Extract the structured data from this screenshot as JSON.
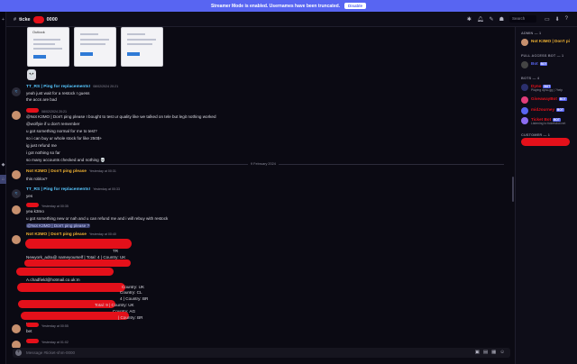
{
  "banner": {
    "text": "Streamer Mode is enabled. Usernames have been truncated.",
    "button": "Disable"
  },
  "guild_rail": {
    "items": [
      "+",
      "◆",
      "⌂"
    ]
  },
  "topbar": {
    "channel_prefix": "ticke",
    "channel_suffix": "0000",
    "search_placeholder": "Search",
    "icons": [
      "threads-icon",
      "bell-icon",
      "pin-icon",
      "members-icon",
      "search-icon",
      "inbox-icon",
      "help-icon"
    ]
  },
  "chat": {
    "thumb_title": "Outlook",
    "skull": "💀",
    "divider": "9 February 2024",
    "messages": [
      {
        "name": "TT_RS | Ping for replacements!",
        "color": "cyan",
        "ts": "08/02/2024 20:21",
        "lines": [
          "yeah just wait for a restock I guess",
          "the accs are bad"
        ]
      },
      {
        "name": "",
        "color": "red",
        "ts": "08/02/2024 20:21",
        "lines": [
          "@Not K3MO | Don't ping please I bought to test ur quality like we talked on tele but legit nothing worked",
          "@wolfyie if u don't remember",
          "u got something normal for me to test?",
          "so i can buy ur whole stock for like 250$+",
          "ig just refund me",
          "i got nothing so far",
          "so many accounts checked and nothing 💀"
        ]
      },
      {
        "name": "Not K3MO | Don't ping please",
        "color": "gold",
        "ts": "Yesterday at 00:31",
        "lines": [
          "this roblox?"
        ]
      },
      {
        "name": "TT_RS | Ping for replacements!",
        "color": "cyan",
        "ts": "Yesterday at 00:33",
        "lines": [
          "yes"
        ]
      },
      {
        "name": "",
        "color": "red",
        "ts": "Yesterday at 00:35",
        "lines": [
          "yea k3mo",
          "u got something new or nah and u can refund me and i will rebuy with restock",
          "@Not K3MO | Don't ping please ?"
        ]
      },
      {
        "name": "Not K3MO | Don't ping please",
        "color": "gold",
        "ts": "Yesterday at 00:40",
        "lines": [
          "TR",
          "Newyork_adra@  nameyourself | Total: 4 | Country: UK",
          "",
          "",
          "A.chadfield@hotmail.co.uk:m",
          "Country: UK",
          "Country: CL",
          "4 | Country: BR",
          "Total: 9 | Country: UK",
          "Country: AG",
          "| Country: BR",
          "try"
        ]
      },
      {
        "name": "",
        "color": "red",
        "ts": "Yesterday at 00:55",
        "lines": [
          "bet"
        ]
      },
      {
        "name": "",
        "color": "red",
        "ts": "Yesterday at 01:02",
        "lines": []
      }
    ]
  },
  "composer": {
    "placeholder": "Message #ticket-shm-0000"
  },
  "members": {
    "groups": [
      {
        "label": "ADMIN — 1",
        "members": [
          {
            "name": "Not K3MO | Don't pi",
            "color": "#f0b232",
            "sub": ""
          }
        ]
      },
      {
        "label": "FULL ACCESS BOT — 1",
        "members": [
          {
            "name": "Bot",
            "color": "#5865f2",
            "sub": "",
            "tag": "BOT"
          }
        ]
      },
      {
        "label": "BOTS — 4",
        "members": [
          {
            "name": "Dyno",
            "color": "#e4101a",
            "sub": "Playing dyno.gg | ?help",
            "tag": "BOT"
          },
          {
            "name": "GiveawayBot",
            "color": "#e4101a",
            "sub": "",
            "tag": "BOT"
          },
          {
            "name": "midJourney",
            "color": "#e4101a",
            "sub": "",
            "tag": "BOT"
          },
          {
            "name": "Ticket Bot",
            "color": "#e4101a",
            "sub": "Listening to ticketsbot.net",
            "tag": "BOT"
          }
        ]
      },
      {
        "label": "CUSTOMER — 1",
        "members": [
          {
            "name": "",
            "color": "#e4101a",
            "sub": ""
          }
        ]
      }
    ]
  }
}
